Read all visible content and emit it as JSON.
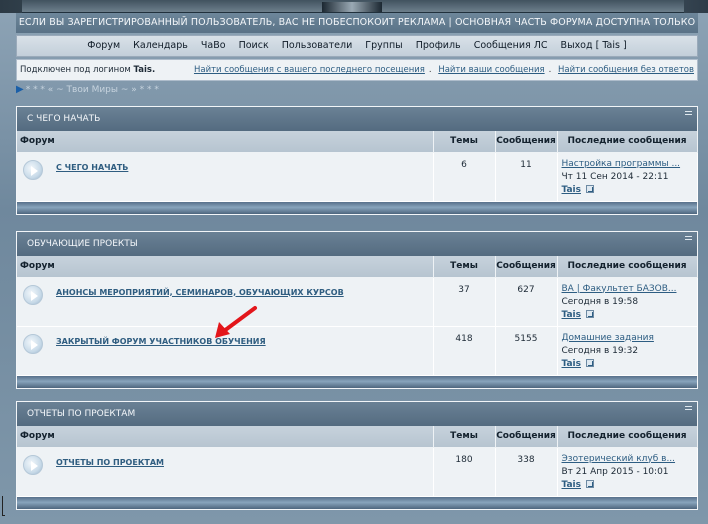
{
  "banner": {
    "notice": "ЕСЛИ ВЫ ЗАРЕГИСТРИРОВАННЫЙ ПОЛЬЗОВАТЕЛЬ, ВАС НЕ ПОБЕСПОКОИТ РЕКЛАМА | ОСНОВНАЯ ЧАСТЬ ФОРУМА ДОСТУПНА ТОЛЬКО УЧАЩИМСЯ ПРОЕКТА"
  },
  "nav": {
    "items": [
      "Форум",
      "Календарь",
      "ЧаВо",
      "Поиск",
      "Пользователи",
      "Группы",
      "Профиль",
      "Сообщения ЛС",
      "Выход [ Tais ]"
    ]
  },
  "userbar": {
    "login_prefix": "Подключен под логином",
    "username": "Tais.",
    "links": [
      "Найти сообщения с вашего последнего посещения",
      "Найти ваши сообщения",
      "Найти сообщения без ответов"
    ]
  },
  "breadcrumb": "* * * « ~ Твои Миры ~ » * * *",
  "table_headers": {
    "forum": "Форум",
    "topics": "Темы",
    "posts": "Сообщения",
    "last": "Последние сообщения"
  },
  "categories": [
    {
      "title": "С ЧЕГО НАЧАТЬ",
      "forums": [
        {
          "name": "С ЧЕГО НАЧАТЬ",
          "topics": "6",
          "posts": "11",
          "last_title": "Настройка программы ...",
          "last_date": "Чт 11 Сен 2014 - 22:11",
          "last_user": "Tais"
        }
      ]
    },
    {
      "title": "ОБУЧАЮЩИЕ ПРОЕКТЫ",
      "forums": [
        {
          "name": "АНОНСЫ МЕРОПРИЯТИЙ, СЕМИНАРОВ, ОБУЧАЮЩИХ КУРСОВ",
          "topics": "37",
          "posts": "627",
          "last_title": "ВА | Факультет БАЗОВ...",
          "last_date": "Сегодня в 19:58",
          "last_user": "Tais"
        },
        {
          "name": "ЗАКРЫТЫЙ ФОРУМ УЧАСТНИКОВ ОБУЧЕНИЯ",
          "topics": "418",
          "posts": "5155",
          "last_title": "Домашние задания",
          "last_date": "Сегодня в 19:32",
          "last_user": "Tais"
        }
      ]
    },
    {
      "title": "ОТЧЕТЫ ПО ПРОЕКТАМ",
      "forums": [
        {
          "name": "ОТЧЕТЫ ПО ПРОЕКТАМ",
          "topics": "180",
          "posts": "338",
          "last_title": "Эзотерический клуб в...",
          "last_date": "Вт 21 Апр 2015 - 10:01",
          "last_user": "Tais"
        }
      ]
    }
  ],
  "colors": {
    "annotation_arrow": "#e3161b",
    "link": "#2d5d82",
    "header_bar": "#5a7287"
  }
}
